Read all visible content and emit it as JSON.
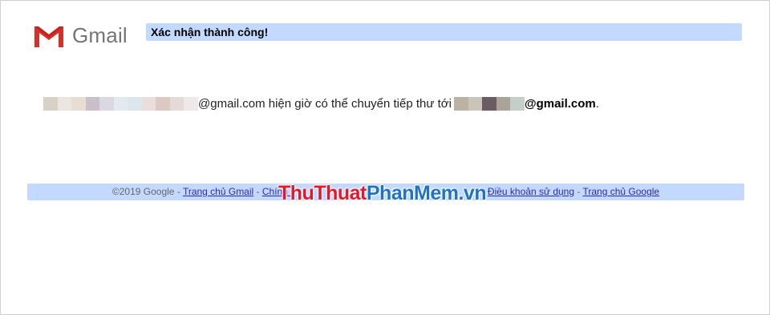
{
  "header": {
    "logo_text": "Gmail",
    "title": "Xác nhận thành công!"
  },
  "message": {
    "middle_text": "@gmail.com hiện giờ có thể chuyển tiếp thư tới",
    "target_domain": "@gmail.com",
    "end_punct": "."
  },
  "footer": {
    "copyright": "©2019 Google",
    "separator": " - ",
    "links": [
      "Trang chủ Gmail",
      "Chính s",
      "Điều khoản sử dụng",
      "Trang chủ Google"
    ]
  },
  "watermark": {
    "part1": "Thu",
    "part2": "Thuat",
    "part3": "Phan",
    "part4": "Mem",
    "part5": ".vn"
  },
  "colors": {
    "accent_bar": "#c3d9ff",
    "link": "#2a2ab8",
    "gmail_red": "#d93025",
    "watermark_red": "#e2182b",
    "watermark_blue": "#1f72c4"
  },
  "redacted_blocks": {
    "source_colors": [
      "#d7d1c8",
      "#ece6e2",
      "#e8ddd3",
      "#cbc0c9",
      "#dcd8e3",
      "#e3e9ef",
      "#dde6ec",
      "#e9dedb",
      "#dcc9c4",
      "#e6dad8",
      "#efe8ea"
    ],
    "target_colors": [
      "#bbb2a6",
      "#c9c5b8",
      "#6a5c60",
      "#aaa39a",
      "#c5cec9"
    ]
  }
}
